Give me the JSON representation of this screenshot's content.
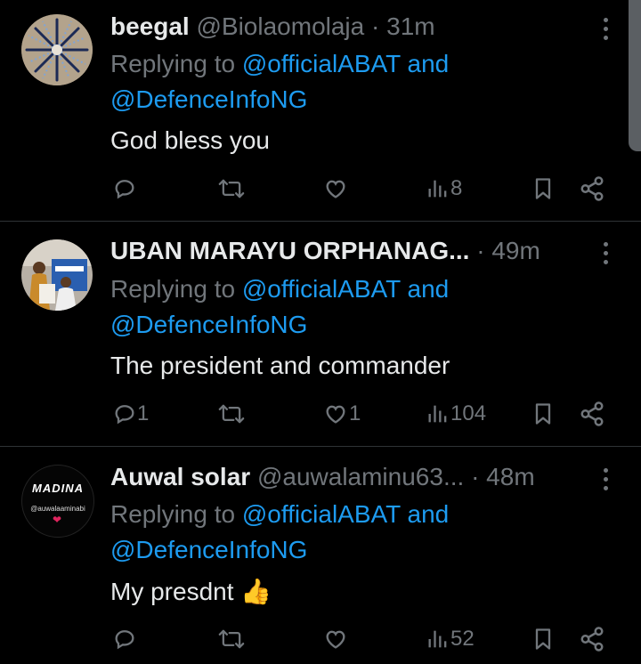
{
  "tweets": [
    {
      "name": "beegal",
      "handle": "@Biolaomolaja",
      "dot": "·",
      "time": "31m",
      "replying_prefix": "Replying to",
      "mention1": "@officialABAT",
      "and": "and",
      "mention2": "@DefenceInfoNG",
      "text": "God bless you",
      "replies": "",
      "likes": "",
      "views": "8"
    },
    {
      "name": "UBAN MARAYU ORPHANAG...",
      "handle": "",
      "dot": "·",
      "time": "49m",
      "replying_prefix": "Replying to",
      "mention1": "@officialABAT",
      "and": "and",
      "mention2": "@DefenceInfoNG",
      "text": "The president and commander",
      "replies": "1",
      "likes": "1",
      "views": "104"
    },
    {
      "name": "Auwal solar",
      "handle": "@auwalaminu63...",
      "dot": "·",
      "time": "48m",
      "replying_prefix": "Replying to",
      "mention1": "@officialABAT",
      "and": "and",
      "mention2": "@DefenceInfoNG",
      "text": "My presdnt 👍",
      "replies": "",
      "likes": "",
      "views": "52",
      "avatar_text": "MADINA",
      "avatar_sub": "@auwalaaminabi"
    }
  ],
  "colors": {
    "background": "#000000",
    "text": "#e7e9ea",
    "muted": "#71767b",
    "link": "#1d9bf0",
    "divider": "#2f3336"
  },
  "icons": [
    "reply-icon",
    "retweet-icon",
    "like-icon",
    "views-icon",
    "bookmark-icon",
    "share-icon",
    "more-icon"
  ]
}
